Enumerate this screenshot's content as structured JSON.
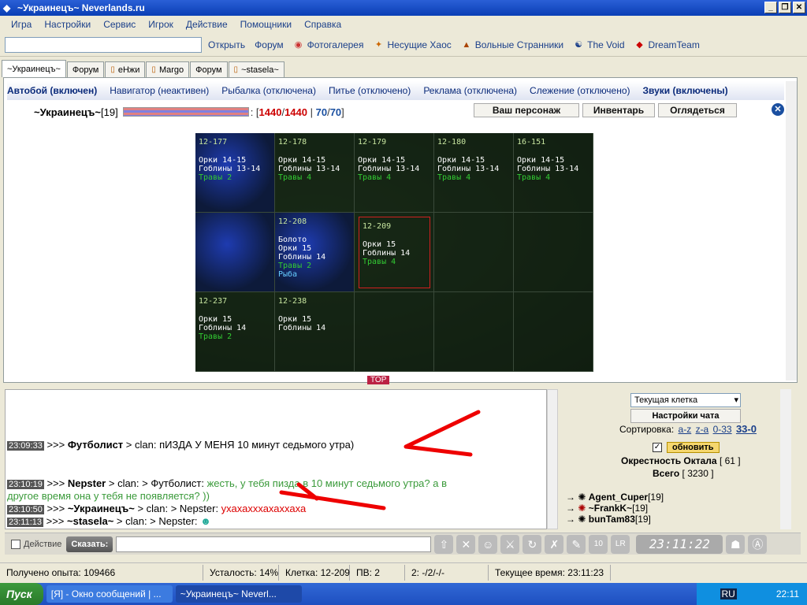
{
  "window": {
    "title": "~Украинецъ~ Neverlands.ru",
    "buttons": [
      "_",
      "❐",
      "✕"
    ]
  },
  "menu": [
    "Игра",
    "Настройки",
    "Сервис",
    "Игрок",
    "Действие",
    "Помощники",
    "Справка"
  ],
  "toolbar": {
    "open_label": "Открыть",
    "links": [
      {
        "label": "Форум",
        "icon": "forum-icon"
      },
      {
        "label": "Фотогалерея",
        "icon": "photo-icon"
      },
      {
        "label": "Несущие Хаос",
        "icon": "clan-icon"
      },
      {
        "label": "Вольные Странники",
        "icon": "clan-icon"
      },
      {
        "label": "The Void",
        "icon": "clan-icon"
      },
      {
        "label": "DreamTeam",
        "icon": "clan-icon"
      }
    ]
  },
  "tabs": [
    "~Украинецъ~",
    "Форум",
    "eHжи",
    "Margo",
    "Форум",
    "~stasela~"
  ],
  "statusrow": {
    "autobattle": "Автобой (включен)",
    "navigator": "Навигатор (неактивен)",
    "fishing": "Рыбалка (отключена)",
    "drinking": "Питье (отключено)",
    "ads": "Реклама (отключена)",
    "tracking": "Слежение (отключено)",
    "sounds": "Звуки (включены)"
  },
  "character": {
    "name": "~Украинецъ~",
    "level": "[19]",
    "hp_current": "1440",
    "hp_max": "1440",
    "mp_current": "70",
    "mp_max": "70",
    "btn_char": "Ваш персонаж",
    "btn_inv": "Инвентарь",
    "btn_look": "Оглядеться"
  },
  "map": {
    "cells": [
      {
        "id": "12-177",
        "lines": [
          "Орки 14-15",
          "Гоблины 13-14"
        ],
        "herbs": "Травы 2"
      },
      {
        "id": "12-178",
        "lines": [
          "Орки 14-15",
          "Гоблины 13-14"
        ],
        "herbs": "Травы 4"
      },
      {
        "id": "12-179",
        "lines": [
          "Орки 14-15",
          "Гоблины 13-14"
        ],
        "herbs": "Травы 4"
      },
      {
        "id": "12-180",
        "lines": [
          "Орки 14-15",
          "Гоблины 13-14"
        ],
        "herbs": "Травы 4"
      },
      {
        "id": "16-151",
        "lines": [
          "Орки 14-15",
          "Гоблины 13-14"
        ],
        "herbs": "Травы 4"
      },
      {
        "id": "",
        "lines": [],
        "herbs": ""
      },
      {
        "id": "12-208",
        "lines": [
          "Болото",
          "Орки 15",
          "Гоблины 14"
        ],
        "herbs": "Травы 2",
        "fish": "Рыба"
      },
      {
        "id": "12-209",
        "lines": [
          "Орки 15",
          "Гоблины 14"
        ],
        "herbs": "Травы 4",
        "selected": true
      },
      {
        "id": "",
        "lines": [],
        "herbs": ""
      },
      {
        "id": "",
        "lines": [],
        "herbs": ""
      },
      {
        "id": "12-237",
        "lines": [
          "Орки 15",
          "Гоблины 14"
        ],
        "herbs": "Травы 2"
      },
      {
        "id": "12-238",
        "lines": [
          "Орки 15",
          "Гоблины 14"
        ],
        "herbs": ""
      },
      {
        "id": "",
        "lines": [],
        "herbs": ""
      },
      {
        "id": "",
        "lines": [],
        "herbs": ""
      },
      {
        "id": "",
        "lines": [],
        "herbs": ""
      }
    ],
    "top_tag": "TOP"
  },
  "chat": [
    {
      "time": "23:09:33",
      "nick": "Футболист",
      "text": " > clan: пИЗДА У МЕНЯ 10 минут седьмого утра)",
      "cls": ""
    },
    {
      "time": "23:10:19",
      "nick": "Nepster",
      "text": " > clan: > Футболист: ",
      "extra": "жесть, у тебя пизда в 10 минут седьмого утра? а в",
      "cls": "green"
    },
    {
      "time": "",
      "nick": "",
      "text": "",
      "extra": "другое время она у тебя не появляется? ))",
      "cls": "green"
    },
    {
      "time": "23:10:50",
      "nick": "~Украинецъ~",
      "text": " > clan: > Nepster: ",
      "extra": "ухахахххахаххаха",
      "cls": "red"
    },
    {
      "time": "23:11:13",
      "nick": "~stasela~",
      "text": " > clan: > Nepster: ",
      "extra": "",
      "cls": ""
    }
  ],
  "rightpanel": {
    "location_select": "Текущая клетка",
    "chat_settings": "Настройки чата",
    "sort_label": "Сортировка:",
    "sort_links": [
      "a-z",
      "z-a",
      "0-33",
      "33-0"
    ],
    "refresh": "обновить",
    "area_label": "Окрестность Октала",
    "area_count": "[ 61 ]",
    "total_label": "Всего",
    "total_count": "[ 3230 ]",
    "players": [
      {
        "name": "Agent_Cuper",
        "level": "[19]"
      },
      {
        "name": "~FrankK~",
        "level": "[19]"
      },
      {
        "name": "bunTam83",
        "level": "[19]"
      }
    ]
  },
  "inputbar": {
    "action_label": "Действие",
    "say_label": "Сказать:",
    "clock": "23:11:22"
  },
  "statusbar": {
    "exp": "Получено опыта: 109466",
    "fatigue": "Усталость: 14%",
    "cell": "Клетка: 12-209",
    "pv": "ПВ: 2",
    "slot": "2: -/2/-/-",
    "time": "Текущее время: 23:11:23"
  },
  "taskbar": {
    "start": "Пуск",
    "tasks": [
      "[Я] - Окно сообщений | ...",
      "~Украинецъ~ Neverl..."
    ],
    "lang": "RU",
    "clock": "22:11"
  }
}
